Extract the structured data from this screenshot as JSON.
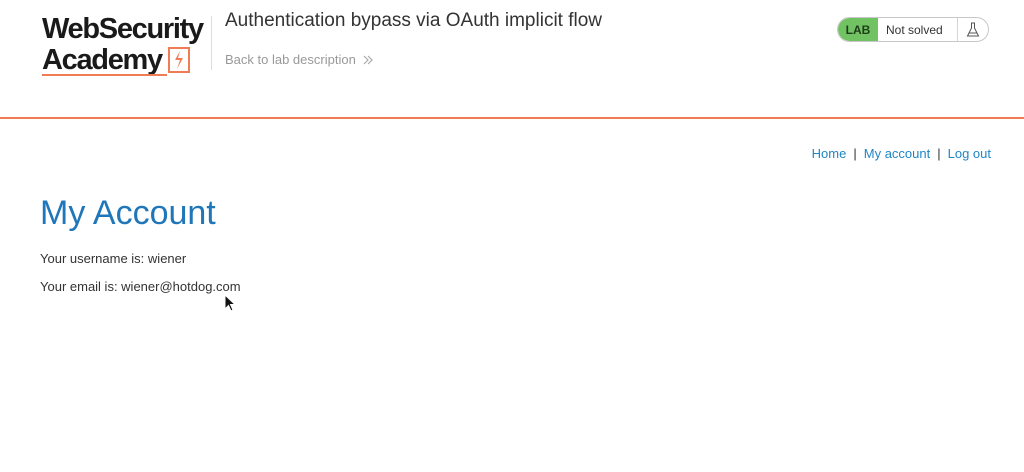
{
  "logo": {
    "line1": "WebSecurity",
    "line2": "Academy"
  },
  "lab": {
    "title": "Authentication bypass via OAuth implicit flow",
    "back_label": "Back to lab description",
    "badge": "LAB",
    "status": "Not solved"
  },
  "nav": {
    "home": "Home",
    "my_account": "My account",
    "logout": "Log out",
    "separator": "|"
  },
  "account": {
    "heading": "My Account",
    "username_label": "Your username is: ",
    "username": "wiener",
    "email_label": "Your email is: ",
    "email": "wiener@hotdog.com"
  },
  "colors": {
    "accent_orange": "#f07c56",
    "link_blue": "#1f86c4",
    "heading_blue": "#1f76b8",
    "lab_green": "#70c262"
  },
  "icons": {
    "logo_mark": "lightning-bolt-icon",
    "back": "double-chevron-right-icon",
    "flask": "flask-icon",
    "cursor": "mouse-pointer-icon"
  }
}
